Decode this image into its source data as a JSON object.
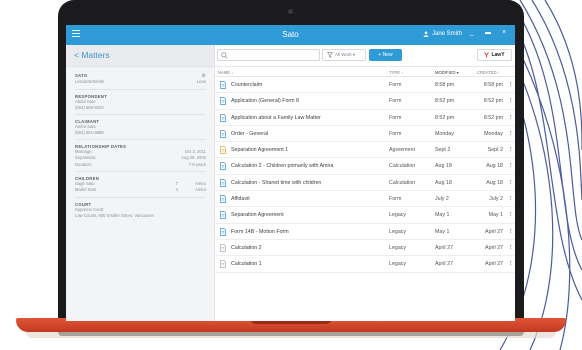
{
  "colors": {
    "accent": "#2f9bd6",
    "laptop_base": "#d84a2b",
    "word_icon": "#3d8fd8",
    "pdf_icon": "#e3a33b",
    "legacy_icon": "#a9adb3"
  },
  "titlebar": {
    "title": "Sato",
    "user": "Jane Smith",
    "minimize": "_",
    "maximize": "▬",
    "close": "×"
  },
  "sidebar": {
    "heading": "< Matters",
    "sato": {
      "title": "SATO",
      "sub": "Lemaitre/Dimitri",
      "sub_right": "Lean"
    },
    "respondent": {
      "title": "RESPONDENT",
      "lines": [
        "Abdul Sato",
        "(604) 505-8203"
      ]
    },
    "claimant": {
      "title": "CLAIMANT",
      "lines": [
        "Amira Sato",
        "(604) 551-9888"
      ]
    },
    "relationship": {
      "title": "RELATIONSHIP DATES",
      "items": [
        {
          "k": "Marriage:",
          "v": "Oct 3, 2011"
        },
        {
          "k": "Separation:",
          "v": "Aug 29, 2002"
        },
        {
          "k": "Duration:",
          "v": "7.8 years"
        }
      ]
    },
    "children": {
      "title": "CHILDREN",
      "items": [
        {
          "k": "Sage Sato",
          "m": "7",
          "v": "Amira"
        },
        {
          "k": "Model Sato",
          "m": "4",
          "v": "Amira"
        }
      ]
    },
    "court": {
      "title": "COURT",
      "lines": [
        "Supreme Court",
        "Law Courts, 800 Smithe Street, Vancouver"
      ]
    }
  },
  "toolbar": {
    "search_placeholder": "Q",
    "filter_label": "All Work ▾",
    "new_label": "+ New",
    "lawy_label": "LawY"
  },
  "table": {
    "headers": {
      "name": "NAME ↓",
      "type": "TYPE ↓",
      "modified": "MODIFIED ▾",
      "created": "CREATED ↓"
    },
    "rows": [
      {
        "icon": "word-doc-icon",
        "name": "Counterclaim",
        "type": "Form",
        "modified": "8:58 pm",
        "created": "8:58 pm"
      },
      {
        "icon": "word-doc-icon",
        "name": "Application (General) Form 8",
        "type": "Form",
        "modified": "8:52 pm",
        "created": "8:52 pm"
      },
      {
        "icon": "word-doc-icon",
        "name": "Application about a Family Law Matter",
        "type": "Form",
        "modified": "8:52 pm",
        "created": "8:52 pm"
      },
      {
        "icon": "word-doc-icon",
        "name": "Order - General",
        "type": "Form",
        "modified": "Monday",
        "created": "Monday"
      },
      {
        "icon": "pdf-doc-icon",
        "name": "Separation Agreement 1",
        "type": "Agreement",
        "modified": "Sept 2",
        "created": "Sept 2"
      },
      {
        "icon": "word-doc-icon",
        "name": "Calculation 2 - Children primarily with Amira",
        "type": "Calculation",
        "modified": "Aug 18",
        "created": "Aug 18"
      },
      {
        "icon": "word-doc-icon",
        "name": "Calculation - Shared time with children",
        "type": "Calculation",
        "modified": "Aug 18",
        "created": "Aug 18"
      },
      {
        "icon": "word-doc-icon",
        "name": "Affidavit",
        "type": "Form",
        "modified": "July 2",
        "created": "July 2"
      },
      {
        "icon": "word-doc-icon",
        "name": "Separation Agreement",
        "type": "Legacy",
        "modified": "May 1",
        "created": "May 1"
      },
      {
        "icon": "word-doc-icon",
        "name": "Form 14B - Motion Form",
        "type": "Legacy",
        "modified": "May 1",
        "created": "April 27"
      },
      {
        "icon": "legacy-doc-icon",
        "name": "Calculation 2",
        "type": "Legacy",
        "modified": "April 27",
        "created": "April 27"
      },
      {
        "icon": "legacy-doc-icon",
        "name": "Calculation 1",
        "type": "Legacy",
        "modified": "April 27",
        "created": "April 27"
      }
    ]
  }
}
